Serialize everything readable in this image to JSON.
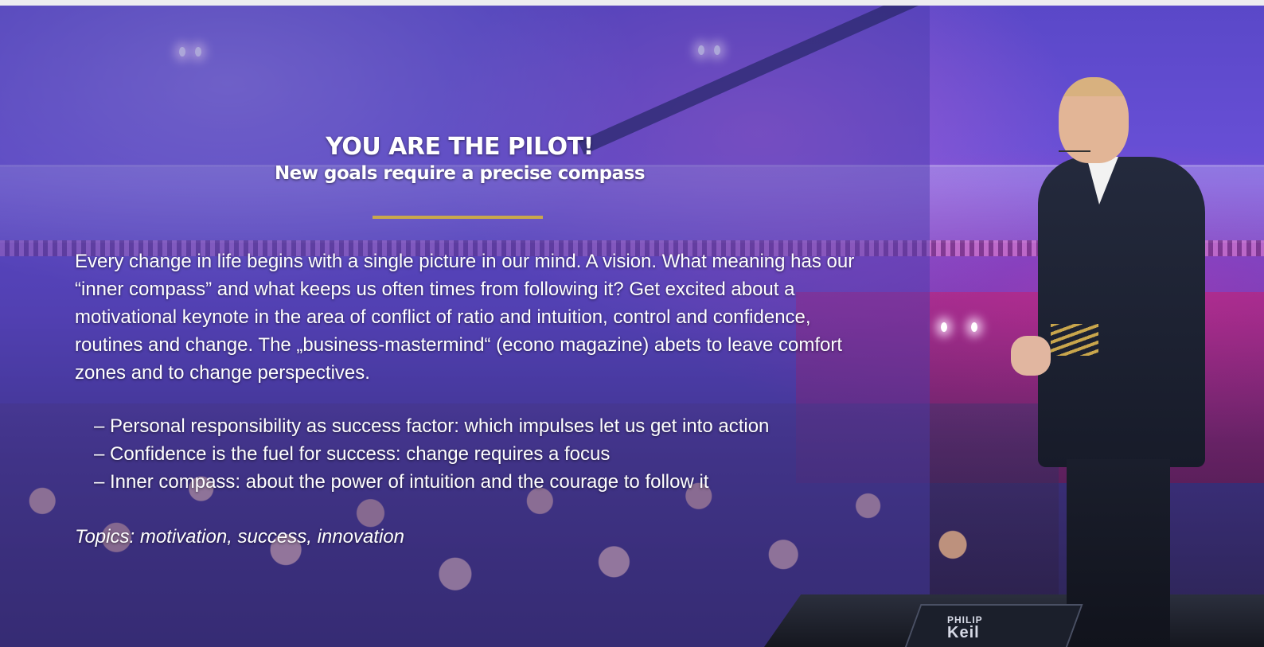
{
  "hero": {
    "title": "YOU ARE THE PILOT!",
    "subtitle": "New goals require a precise compass",
    "divider_color": "#c9a84c",
    "intro": "Every change in life begins with a single picture in our mind. A vision. What meaning has our “inner compass” and what keeps us often times from following it? Get excited about a motivational keynote in the area of conflict of ratio and intuition, control and confidence, routines and change. The „business-mastermind“ (econo magazine) abets to leave comfort zones and to change perspectives.",
    "bullets": [
      "– Personal responsibility as success factor: which impulses let us get into action",
      "– Confidence is the fuel for success: change requires a focus",
      "– Inner compass: about the power of intuition and the courage to follow it"
    ],
    "topics": "Topics: motivation, success, innovation"
  },
  "stage_monitor": {
    "label_line1": "PHILIP",
    "label_line2": "Keil"
  }
}
